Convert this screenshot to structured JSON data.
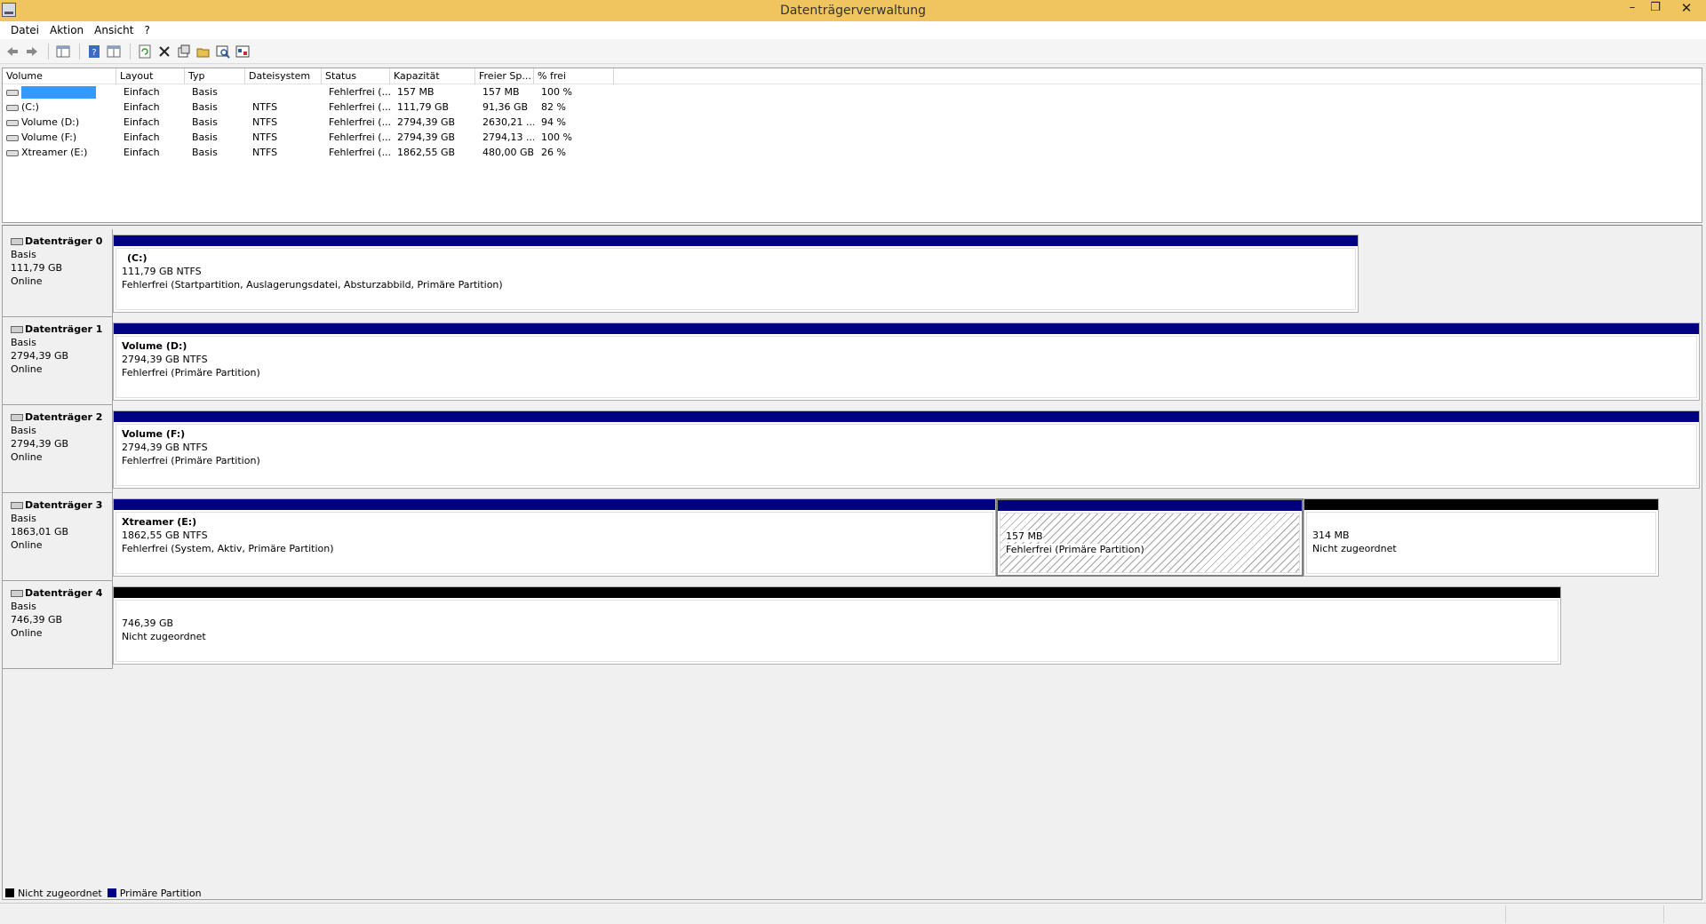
{
  "window": {
    "title": "Datenträgerverwaltung"
  },
  "window_buttons": {
    "minimize": "–",
    "restore": "❐",
    "close": "✕"
  },
  "menu": {
    "items": [
      {
        "label": "Datei"
      },
      {
        "label": "Aktion"
      },
      {
        "label": "Ansicht"
      },
      {
        "label": "?"
      }
    ]
  },
  "toolbar": {
    "buttons": [
      "back-icon",
      "forward-icon",
      "show-hide-console-tree-icon",
      "help-icon",
      "view-icon",
      "refresh-icon",
      "delete-icon",
      "properties-icon",
      "open-icon",
      "explore-icon",
      "settings-icon"
    ]
  },
  "volume_list": {
    "columns": [
      "Volume",
      "Layout",
      "Typ",
      "Dateisystem",
      "Status",
      "Kapazität",
      "Freier Sp...",
      "% frei"
    ],
    "rows": [
      {
        "volume": "",
        "layout": "Einfach",
        "typ": "Basis",
        "fs": "",
        "status": "Fehlerfrei (...",
        "kap": "157 MB",
        "frei": "157 MB",
        "pct": "100 %",
        "selected": true
      },
      {
        "volume": "(C:)",
        "layout": "Einfach",
        "typ": "Basis",
        "fs": "NTFS",
        "status": "Fehlerfrei (...",
        "kap": "111,79 GB",
        "frei": "91,36 GB",
        "pct": "82 %"
      },
      {
        "volume": "Volume (D:)",
        "layout": "Einfach",
        "typ": "Basis",
        "fs": "NTFS",
        "status": "Fehlerfrei (...",
        "kap": "2794,39 GB",
        "frei": "2630,21 ...",
        "pct": "94 %"
      },
      {
        "volume": "Volume (F:)",
        "layout": "Einfach",
        "typ": "Basis",
        "fs": "NTFS",
        "status": "Fehlerfrei (...",
        "kap": "2794,39 GB",
        "frei": "2794,13 ...",
        "pct": "100 %"
      },
      {
        "volume": "Xtreamer (E:)",
        "layout": "Einfach",
        "typ": "Basis",
        "fs": "NTFS",
        "status": "Fehlerfrei (...",
        "kap": "1862,55 GB",
        "frei": "480,00 GB",
        "pct": "26 %"
      }
    ]
  },
  "disks": [
    {
      "name": "Datenträger 0",
      "type": "Basis",
      "size": "111,79 GB",
      "state": "Online",
      "partitions": [
        {
          "title": "(C:)",
          "size": "111,79 GB NTFS",
          "status": "Fehlerfrei (Startpartition, Auslagerungsdatei, Absturzabbild, Primäre Partition)",
          "kind": "primary"
        }
      ]
    },
    {
      "name": "Datenträger 1",
      "type": "Basis",
      "size": "2794,39 GB",
      "state": "Online",
      "partitions": [
        {
          "title": "Volume  (D:)",
          "size": "2794,39 GB NTFS",
          "status": "Fehlerfrei (Primäre Partition)",
          "kind": "primary"
        }
      ]
    },
    {
      "name": "Datenträger 2",
      "type": "Basis",
      "size": "2794,39 GB",
      "state": "Online",
      "partitions": [
        {
          "title": "Volume  (F:)",
          "size": "2794,39 GB NTFS",
          "status": "Fehlerfrei (Primäre Partition)",
          "kind": "primary"
        }
      ]
    },
    {
      "name": "Datenträger 3",
      "type": "Basis",
      "size": "1863,01 GB",
      "state": "Online",
      "partitions": [
        {
          "title": "Xtreamer  (E:)",
          "size": "1862,55 GB NTFS",
          "status": "Fehlerfrei (System, Aktiv, Primäre Partition)",
          "kind": "primary"
        },
        {
          "title": "",
          "size": "157 MB",
          "status": "Fehlerfrei (Primäre Partition)",
          "kind": "primary-selected"
        },
        {
          "title": "",
          "size": "314 MB",
          "status": "Nicht zugeordnet",
          "kind": "unallocated"
        }
      ]
    },
    {
      "name": "Datenträger 4",
      "type": "Basis",
      "size": "746,39 GB",
      "state": "Online",
      "partitions": [
        {
          "title": "",
          "size": "746,39 GB",
          "status": "Nicht zugeordnet",
          "kind": "unallocated"
        }
      ]
    }
  ],
  "legend": {
    "items": [
      {
        "label": "Nicht zugeordnet",
        "color": "#000000"
      },
      {
        "label": "Primäre Partition",
        "color": "#000080"
      }
    ]
  },
  "colors": {
    "titlebar": "#f0c45e",
    "primary": "#000080",
    "unallocated": "#000000",
    "selection": "#3399ff"
  }
}
